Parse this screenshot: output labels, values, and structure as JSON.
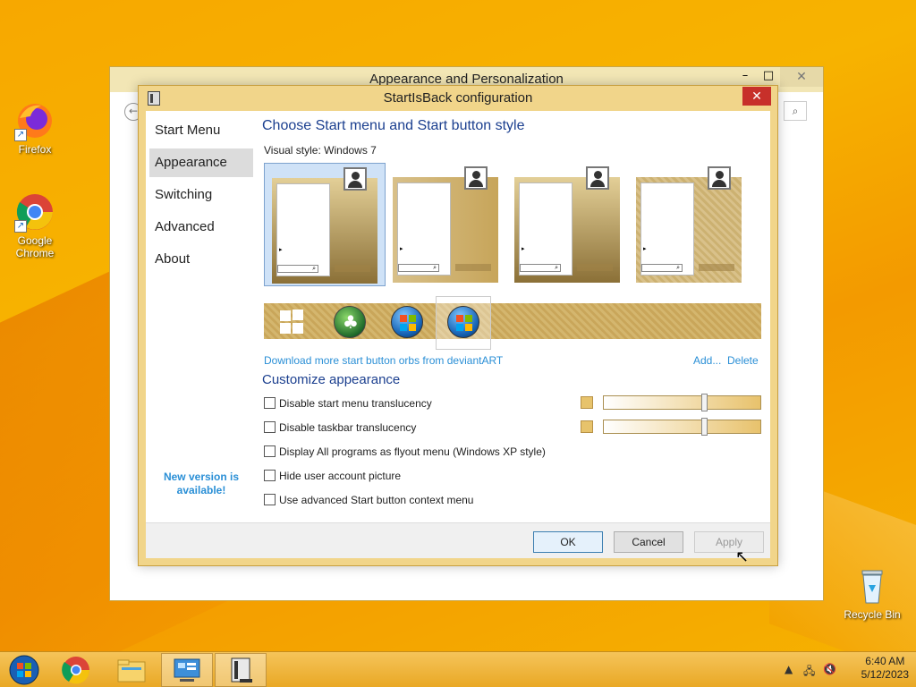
{
  "colors": {
    "accent": "#f1d58a",
    "heading": "#1b3f8f",
    "link": "#2a8fd6",
    "close_red": "#c7302a"
  },
  "desktop": {
    "icons": [
      {
        "label": "Firefox",
        "icon": "firefox-icon"
      },
      {
        "label": "Google Chrome",
        "icon": "chrome-icon"
      },
      {
        "label": "Recycle Bin",
        "icon": "recycle-bin-icon"
      }
    ]
  },
  "background_window": {
    "title": "Appearance and Personalization",
    "minimize": "–",
    "maximize": "□",
    "close": "✕",
    "back": "←",
    "search": "⌕"
  },
  "dialog": {
    "title": "StartIsBack configuration",
    "close": "✕",
    "nav": [
      {
        "label": "Start Menu",
        "selected": false
      },
      {
        "label": "Appearance",
        "selected": true
      },
      {
        "label": "Switching",
        "selected": false
      },
      {
        "label": "Advanced",
        "selected": false
      },
      {
        "label": "About",
        "selected": false
      }
    ],
    "new_version": "New version is available!",
    "heading_style": "Choose Start menu and Start button style",
    "visual_style_label": "Visual style:",
    "visual_style_value": "Windows 7",
    "orbs": [
      "windows-8-logo-orb",
      "clover-orb",
      "windows-7-orb",
      "windows-7-orb-selected"
    ],
    "download_link": "Download more start button orbs from deviantART",
    "add_link": "Add...",
    "delete_link": "Delete",
    "heading_customize": "Customize appearance",
    "options": [
      {
        "label": "Disable start menu translucency",
        "checked": false
      },
      {
        "label": "Disable taskbar translucency",
        "checked": false
      },
      {
        "label": "Display All programs as flyout menu (Windows XP style)",
        "checked": false
      },
      {
        "label": "Hide user account picture",
        "checked": false
      },
      {
        "label": "Use advanced Start button context menu",
        "checked": false
      }
    ],
    "sliders": [
      {
        "value": 0.65
      },
      {
        "value": 0.65
      }
    ],
    "buttons": {
      "ok": "OK",
      "cancel": "Cancel",
      "apply": "Apply"
    }
  },
  "taskbar": {
    "items": [
      "start-orb-icon",
      "chrome-icon",
      "file-explorer-icon",
      "control-panel-icon",
      "startisback-icon"
    ],
    "tray": {
      "time": "6:40 AM",
      "date": "5/12/2023",
      "show_hidden": "▲"
    }
  }
}
